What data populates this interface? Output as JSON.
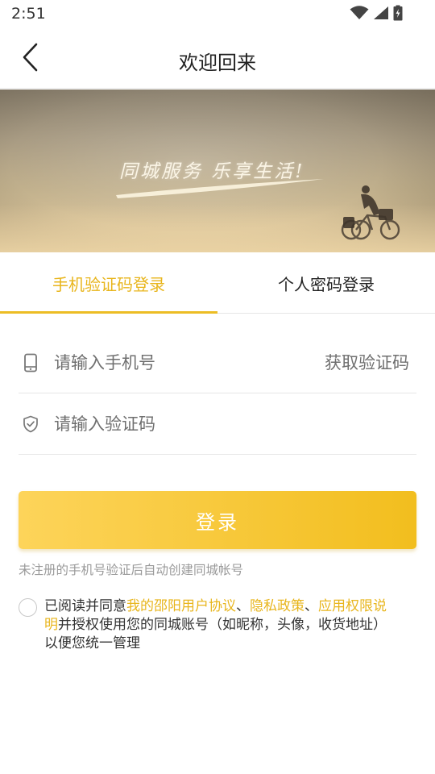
{
  "status_bar": {
    "time": "2:51",
    "icons": [
      "wifi-icon",
      "cellular-signal-icon",
      "battery-charging-icon"
    ]
  },
  "nav": {
    "back_icon": "chevron-left-icon",
    "title": "欢迎回来"
  },
  "banner": {
    "slogan": "同城服务  乐享生活!"
  },
  "tabs": [
    {
      "label": "手机验证码登录",
      "active": true
    },
    {
      "label": "个人密码登录",
      "active": false
    }
  ],
  "form": {
    "phone": {
      "icon": "smartphone-icon",
      "placeholder": "请输入手机号",
      "value": ""
    },
    "get_code_label": "获取验证码",
    "code": {
      "icon": "shield-check-icon",
      "placeholder": "请输入验证码",
      "value": ""
    }
  },
  "login_button": "登录",
  "register_hint": "未注册的手机号验证后自动创建同城帐号",
  "agreement": {
    "checked": false,
    "prefix": "已阅读并同意",
    "link_user_agreement": "我的邵阳用户协议",
    "sep1": "、",
    "link_privacy": "隐私政策",
    "sep2": "、",
    "link_permissions": "应用权限说明",
    "suffix": "并授权使用您的同城账号（如昵称，头像，收货地址）以便您统一管理"
  },
  "colors": {
    "accent": "#ecbd24",
    "accent_text": "#e8b51c",
    "button_gradient_start": "#fdd45a",
    "button_gradient_end": "#f2be1e"
  }
}
